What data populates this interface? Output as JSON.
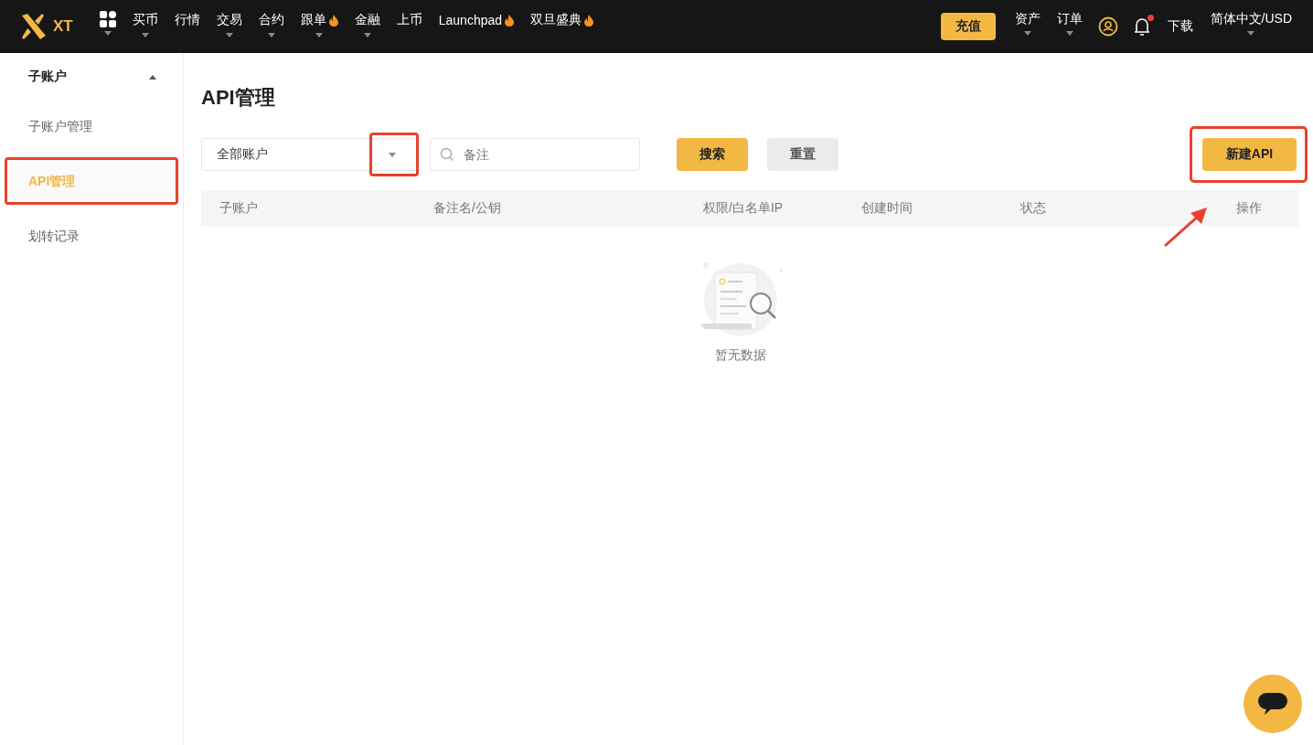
{
  "topbar": {
    "logo": "XT",
    "nav": [
      {
        "label": "买币",
        "dropdown": true,
        "hot": false
      },
      {
        "label": "行情",
        "dropdown": false,
        "hot": false
      },
      {
        "label": "交易",
        "dropdown": true,
        "hot": false
      },
      {
        "label": "合约",
        "dropdown": true,
        "hot": false
      },
      {
        "label": "跟单",
        "dropdown": true,
        "hot": true
      },
      {
        "label": "金融",
        "dropdown": true,
        "hot": false
      },
      {
        "label": "上币",
        "dropdown": false,
        "hot": false
      },
      {
        "label": "Launchpad",
        "dropdown": false,
        "hot": true
      },
      {
        "label": "双旦盛典",
        "dropdown": false,
        "hot": true
      }
    ],
    "deposit_button": "充值",
    "right_menu": [
      {
        "label": "资产",
        "dropdown": true
      },
      {
        "label": "订单",
        "dropdown": true
      }
    ],
    "notifications_unread": true,
    "download": "下载",
    "language": {
      "label": "简体中文/USD",
      "dropdown": true
    }
  },
  "sidebar": {
    "group": {
      "label": "子账户",
      "expanded": true
    },
    "items": [
      {
        "label": "子账户管理",
        "selected": false,
        "highlighted": false
      },
      {
        "label": "API管理",
        "selected": true,
        "highlighted": true
      },
      {
        "label": "划转记录",
        "selected": false,
        "highlighted": false
      }
    ]
  },
  "page_title": "API管理",
  "filters": {
    "account_select": {
      "value": "全部账户",
      "caret_highlighted": true
    },
    "note_search": {
      "placeholder": "备注"
    },
    "search_button": "搜索",
    "reset_button": "重置"
  },
  "new_api_button": {
    "label": "新建API",
    "highlighted": true,
    "arrow": true
  },
  "table": {
    "columns": [
      "子账户",
      "备注名/公钥",
      "权限/白名单IP",
      "创建时间",
      "状态",
      "操作"
    ],
    "empty_text": "暂无数据"
  }
}
